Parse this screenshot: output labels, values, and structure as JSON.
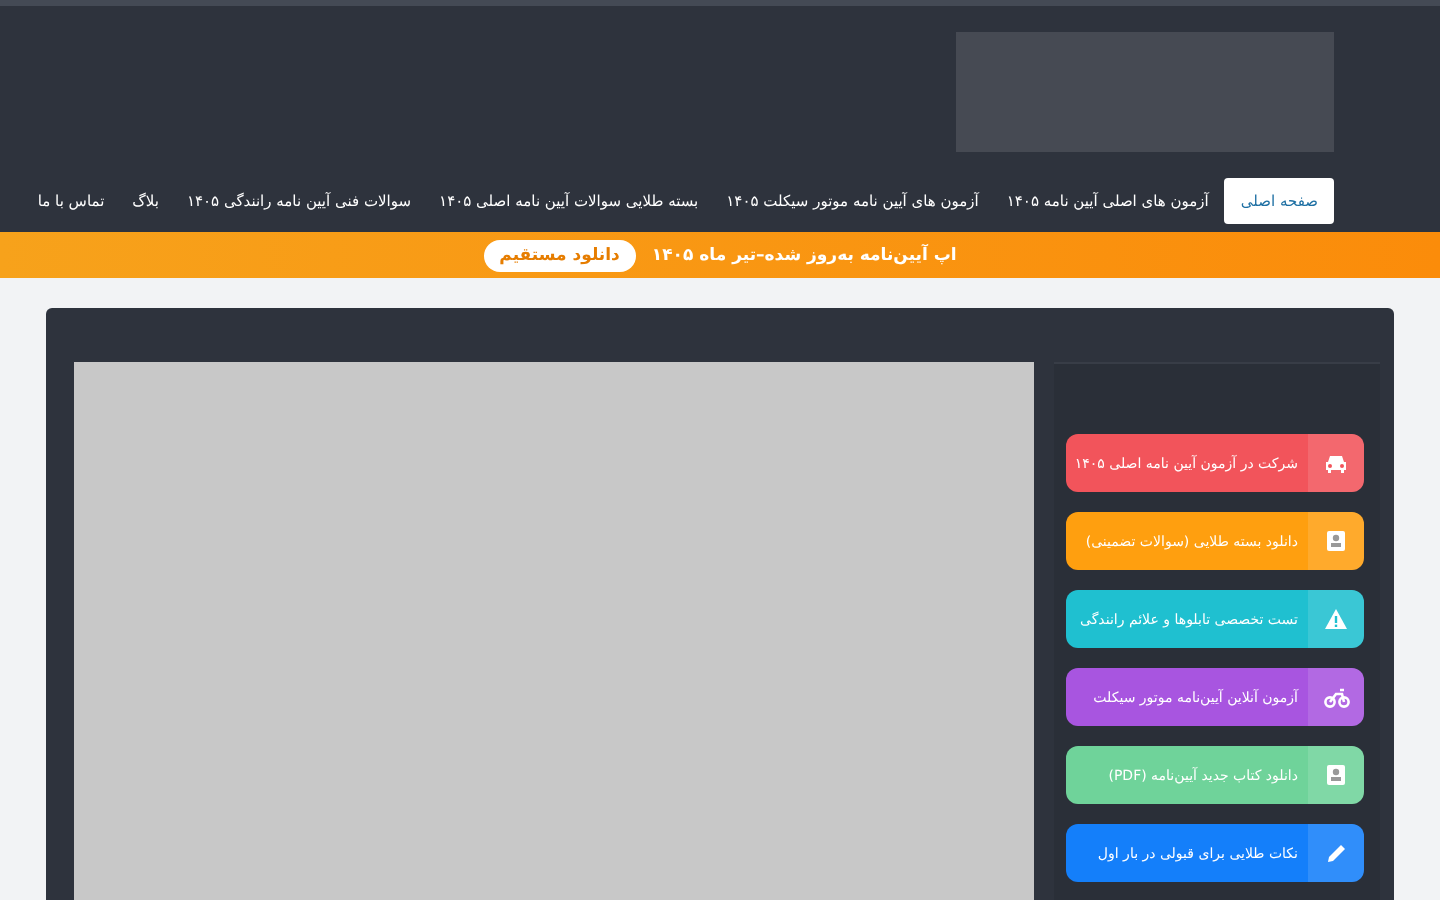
{
  "nav": {
    "items": [
      {
        "label": "صفحه اصلی",
        "selected": true
      },
      {
        "label": "آزمون های اصلی آیین نامه ۱۴۰۵",
        "selected": false
      },
      {
        "label": "آزمون های آیین نامه موتور سیکلت ۱۴۰۵",
        "selected": false
      },
      {
        "label": "بسته طلایی سوالات آیین نامه اصلی ۱۴۰۵",
        "selected": false
      },
      {
        "label": "سوالات فنی آیین نامه رانندگی ۱۴۰۵",
        "selected": false
      },
      {
        "label": "بلاگ",
        "selected": false
      },
      {
        "label": "تماس با ما",
        "selected": false
      }
    ]
  },
  "banner": {
    "text": "اپ آیین‌نامه به‌روز شده–تیر ماه ۱۴۰۵",
    "button": "دانلود مستقیم"
  },
  "sidebar": {
    "links": [
      {
        "label": "شرکت در آزمون آیین نامه اصلی ۱۴۰۵",
        "kind": "car",
        "color": "#f2545b"
      },
      {
        "label": "دانلود بسته طلایی (سوالات تضمینی)",
        "kind": "contact",
        "color": "#ff9f0f"
      },
      {
        "label": "تست تخصصی تابلوها و علائم رانندگی",
        "kind": "warning",
        "color": "#1fc0d0"
      },
      {
        "label": "آزمون آنلاین آیین‌نامه موتور سیکلت",
        "kind": "motorcycle",
        "color": "#a855e0"
      },
      {
        "label": "دانلود کتاب جدید آیین‌نامه (PDF)",
        "kind": "contact",
        "color": "#6fd39a"
      },
      {
        "label": "نکات طلایی برای قبولی در بار اول",
        "kind": "pencil",
        "color": "#147ffa"
      }
    ]
  }
}
